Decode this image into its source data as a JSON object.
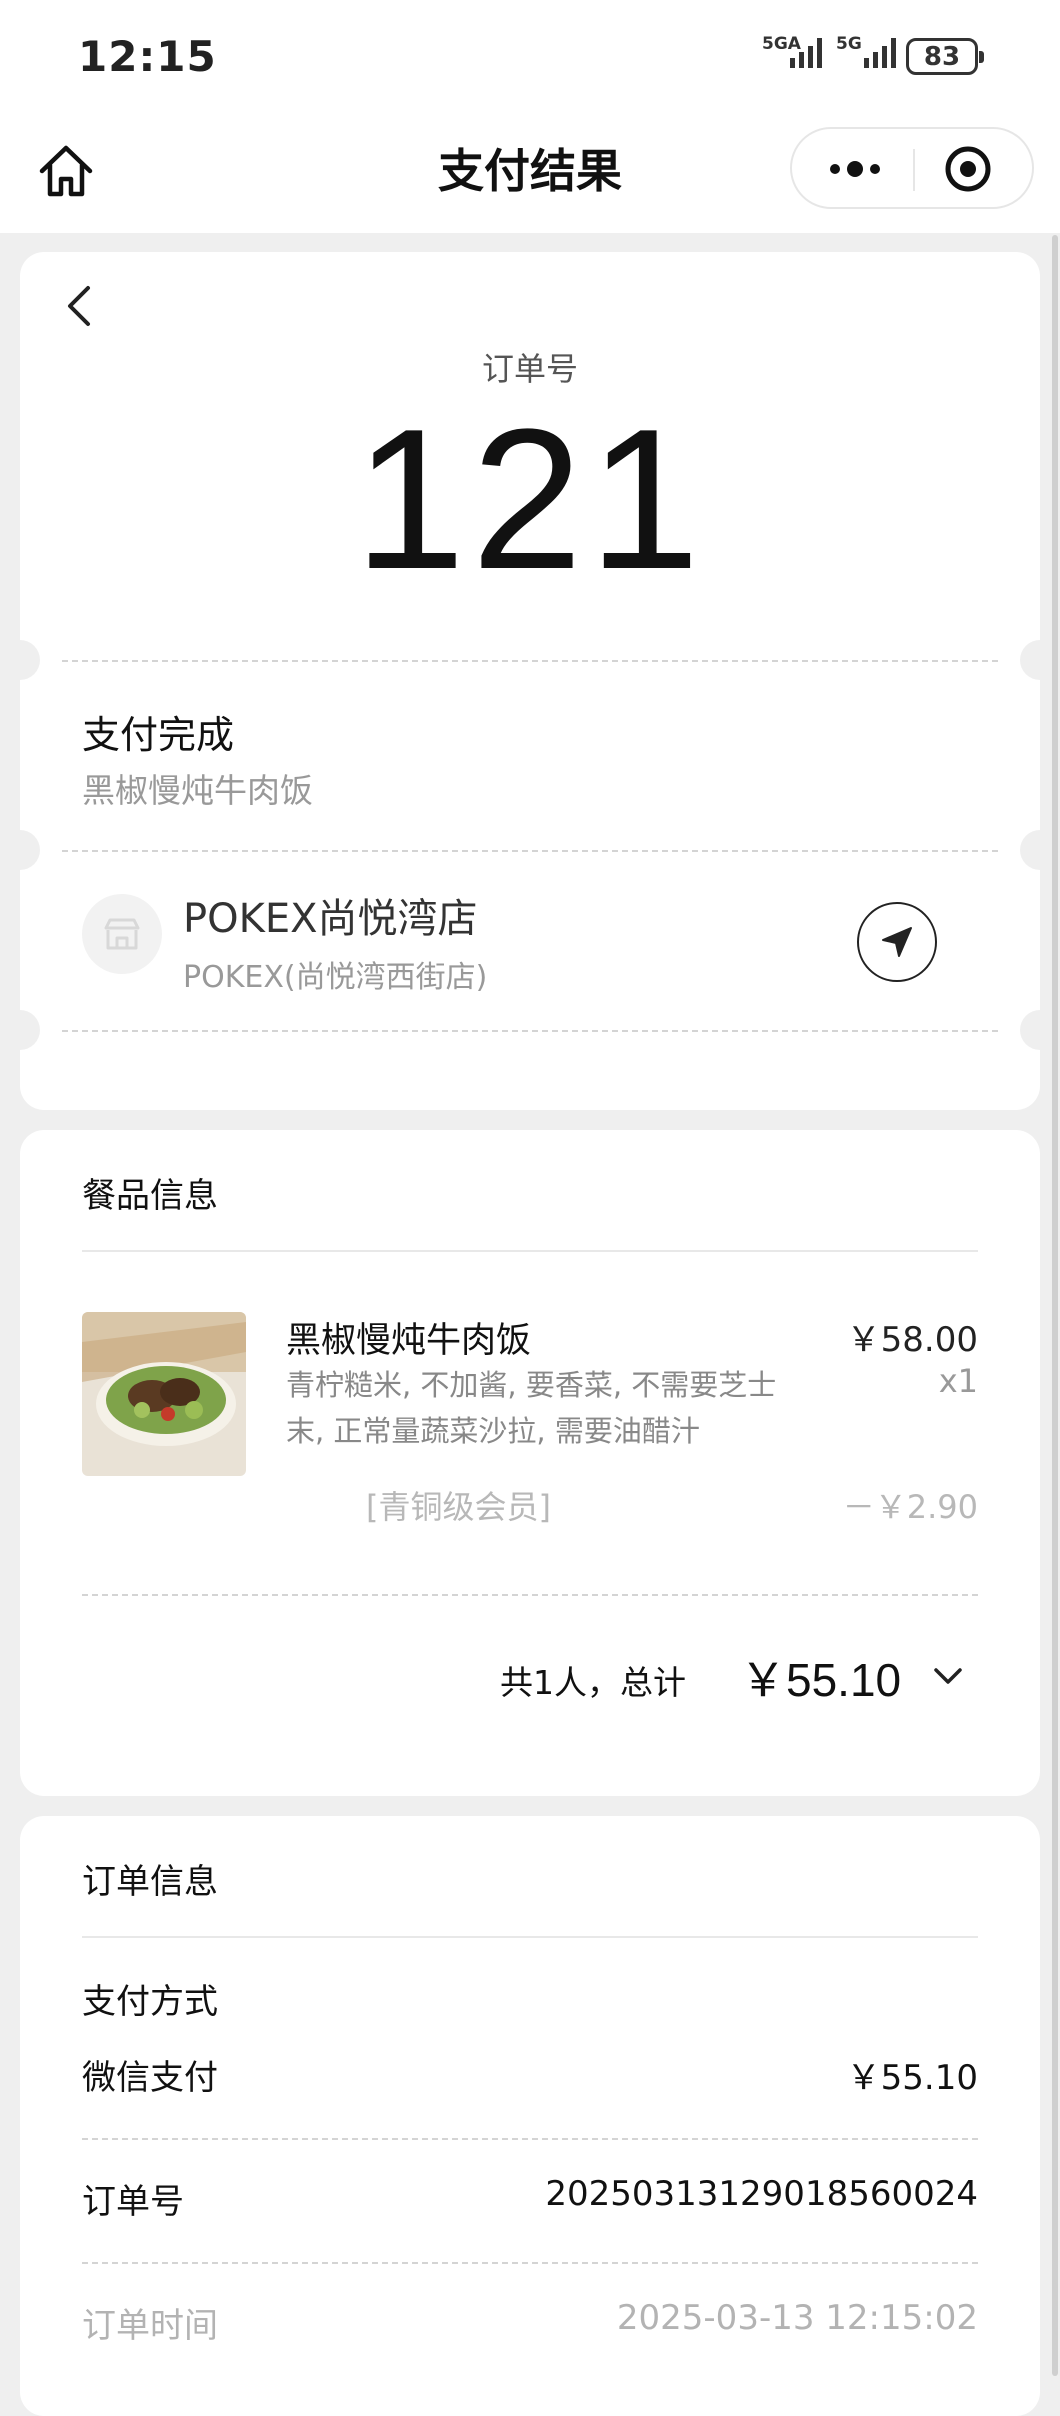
{
  "status_bar": {
    "time": "12:15",
    "signal1_label": "5GA",
    "signal2_label": "5G",
    "battery": "83"
  },
  "nav": {
    "title": "支付结果"
  },
  "order_card": {
    "order_label": "订单号",
    "order_number": "121",
    "pay_status": "支付完成",
    "item_name": "黑椒慢炖牛肉饭",
    "store_name": "POKEX尚悦湾店",
    "store_branch": "POKEX(尚悦湾西街店)"
  },
  "meal_card": {
    "title": "餐品信息",
    "dish": {
      "name": "黑椒慢炖牛肉饭",
      "options_line1": "青柠糙米, 不加酱, 要香菜, 不需要芝士",
      "options_line2": "末, 正常量蔬菜沙拉, 需要油醋汁",
      "price": "￥58.00",
      "qty": "x1"
    },
    "member_label": "[青铜级会员]",
    "member_discount": "－￥2.90",
    "summary_label": "共1人，总计",
    "summary_total": "￥55.10"
  },
  "order_info": {
    "title": "订单信息",
    "payment_method_label": "支付方式",
    "payment_method": "微信支付",
    "payment_amount": "￥55.10",
    "order_no_label": "订单号",
    "order_no": "20250313129018560024",
    "order_time_label": "订单时间",
    "order_time": "2025-03-13 12:15:02"
  }
}
